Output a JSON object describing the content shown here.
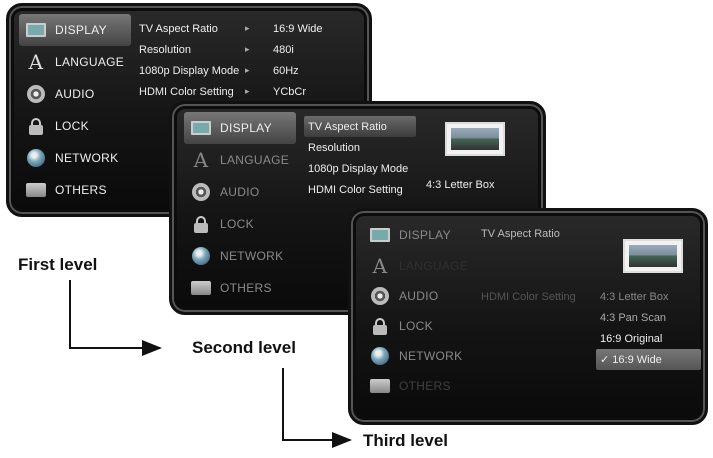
{
  "menu": {
    "display": "DISPLAY",
    "language": "LANGUAGE",
    "audio": "AUDIO",
    "lock": "LOCK",
    "network": "NETWORK",
    "others": "OTHERS"
  },
  "screen1": {
    "settings": [
      {
        "name": "TV Aspect Ratio",
        "value": "16:9 Wide"
      },
      {
        "name": "Resolution",
        "value": "480i"
      },
      {
        "name": "1080p Display Mode",
        "value": "60Hz"
      },
      {
        "name": "HDMI Color Setting",
        "value": "YCbCr"
      }
    ]
  },
  "screen2": {
    "settings": [
      "TV Aspect Ratio",
      "Resolution",
      "1080p Display Mode",
      "HDMI Color Setting"
    ],
    "preview_value": "4:3 Letter Box"
  },
  "screen3": {
    "settings": [
      "TV Aspect Ratio",
      "HDMI Color Setting"
    ],
    "options": [
      "4:3 Letter Box",
      "4:3 Pan Scan",
      "16:9 Original",
      "✓ 16:9 Wide"
    ]
  },
  "labels": {
    "first": "First level",
    "second": "Second level",
    "third": "Third level"
  }
}
